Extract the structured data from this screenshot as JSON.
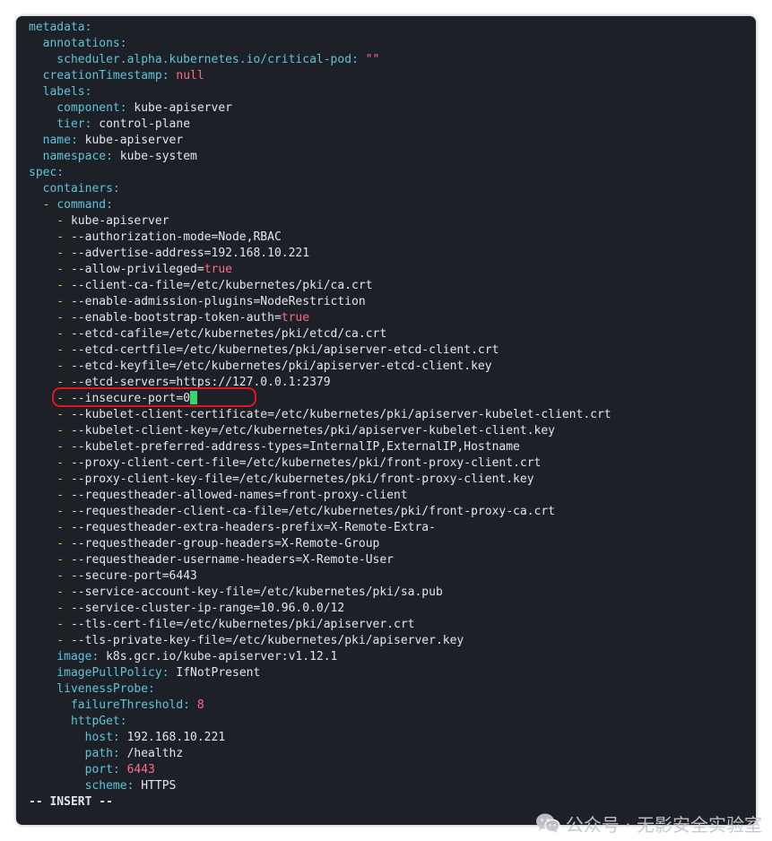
{
  "highlighted_line_index": 23,
  "lines": [
    [
      {
        "t": "metadata:",
        "c": "k"
      }
    ],
    [
      {
        "t": "  annotations:",
        "c": "k"
      }
    ],
    [
      {
        "t": "    scheduler.alpha.kubernetes.io/critical-pod:",
        "c": "k"
      },
      {
        "t": " \"\"",
        "c": "n"
      }
    ],
    [
      {
        "t": "  creationTimestamp:",
        "c": "k"
      },
      {
        "t": " null",
        "c": "n"
      }
    ],
    [
      {
        "t": "  labels:",
        "c": "k"
      }
    ],
    [
      {
        "t": "    component:",
        "c": "k"
      },
      {
        "t": " kube-apiserver",
        "c": "s"
      }
    ],
    [
      {
        "t": "    tier:",
        "c": "k"
      },
      {
        "t": " control-plane",
        "c": "s"
      }
    ],
    [
      {
        "t": "  name:",
        "c": "k"
      },
      {
        "t": " kube-apiserver",
        "c": "s"
      }
    ],
    [
      {
        "t": "  namespace:",
        "c": "k"
      },
      {
        "t": " kube-system",
        "c": "s"
      }
    ],
    [
      {
        "t": "spec:",
        "c": "k"
      }
    ],
    [
      {
        "t": "  containers:",
        "c": "k"
      }
    ],
    [
      {
        "t": "  - ",
        "c": "d"
      },
      {
        "t": "command:",
        "c": "k"
      }
    ],
    [
      {
        "t": "    - ",
        "c": "d"
      },
      {
        "t": "kube-apiserver",
        "c": "s"
      }
    ],
    [
      {
        "t": "    - ",
        "c": "d"
      },
      {
        "t": "--authorization-mode=Node,RBAC",
        "c": "s"
      }
    ],
    [
      {
        "t": "    - ",
        "c": "d"
      },
      {
        "t": "--advertise-address=192.168.10.221",
        "c": "s"
      }
    ],
    [
      {
        "t": "    - ",
        "c": "d"
      },
      {
        "t": "--allow-privileged=",
        "c": "s"
      },
      {
        "t": "true",
        "c": "n"
      }
    ],
    [
      {
        "t": "    - ",
        "c": "d"
      },
      {
        "t": "--client-ca-file=/etc/kubernetes/pki/ca.crt",
        "c": "s"
      }
    ],
    [
      {
        "t": "    - ",
        "c": "d"
      },
      {
        "t": "--enable-admission-plugins=NodeRestriction",
        "c": "s"
      }
    ],
    [
      {
        "t": "    - ",
        "c": "d"
      },
      {
        "t": "--enable-bootstrap-token-auth=",
        "c": "s"
      },
      {
        "t": "true",
        "c": "n"
      }
    ],
    [
      {
        "t": "    - ",
        "c": "d"
      },
      {
        "t": "--etcd-cafile=/etc/kubernetes/pki/etcd/ca.crt",
        "c": "s"
      }
    ],
    [
      {
        "t": "    - ",
        "c": "d"
      },
      {
        "t": "--etcd-certfile=/etc/kubernetes/pki/apiserver-etcd-client.crt",
        "c": "s"
      }
    ],
    [
      {
        "t": "    - ",
        "c": "d"
      },
      {
        "t": "--etcd-keyfile=/etc/kubernetes/pki/apiserver-etcd-client.key",
        "c": "s"
      }
    ],
    [
      {
        "t": "    - ",
        "c": "d"
      },
      {
        "t": "--etcd-servers=https://127.0.0.1:2379",
        "c": "s"
      }
    ],
    [
      {
        "t": "    - ",
        "c": "d"
      },
      {
        "t": "--insecure-port=0",
        "c": "s"
      },
      {
        "cursor": true
      }
    ],
    [
      {
        "t": "    - ",
        "c": "d"
      },
      {
        "t": "--kubelet-client-certificate=/etc/kubernetes/pki/apiserver-kubelet-client.crt",
        "c": "s"
      }
    ],
    [
      {
        "t": "    - ",
        "c": "d"
      },
      {
        "t": "--kubelet-client-key=/etc/kubernetes/pki/apiserver-kubelet-client.key",
        "c": "s"
      }
    ],
    [
      {
        "t": "    - ",
        "c": "d"
      },
      {
        "t": "--kubelet-preferred-address-types=InternalIP,ExternalIP,Hostname",
        "c": "s"
      }
    ],
    [
      {
        "t": "    - ",
        "c": "d"
      },
      {
        "t": "--proxy-client-cert-file=/etc/kubernetes/pki/front-proxy-client.crt",
        "c": "s"
      }
    ],
    [
      {
        "t": "    - ",
        "c": "d"
      },
      {
        "t": "--proxy-client-key-file=/etc/kubernetes/pki/front-proxy-client.key",
        "c": "s"
      }
    ],
    [
      {
        "t": "    - ",
        "c": "d"
      },
      {
        "t": "--requestheader-allowed-names=front-proxy-client",
        "c": "s"
      }
    ],
    [
      {
        "t": "    - ",
        "c": "d"
      },
      {
        "t": "--requestheader-client-ca-file=/etc/kubernetes/pki/front-proxy-ca.crt",
        "c": "s"
      }
    ],
    [
      {
        "t": "    - ",
        "c": "d"
      },
      {
        "t": "--requestheader-extra-headers-prefix=X-Remote-Extra-",
        "c": "s"
      }
    ],
    [
      {
        "t": "    - ",
        "c": "d"
      },
      {
        "t": "--requestheader-group-headers=X-Remote-Group",
        "c": "s"
      }
    ],
    [
      {
        "t": "    - ",
        "c": "d"
      },
      {
        "t": "--requestheader-username-headers=X-Remote-User",
        "c": "s"
      }
    ],
    [
      {
        "t": "    - ",
        "c": "d"
      },
      {
        "t": "--secure-port=6443",
        "c": "s"
      }
    ],
    [
      {
        "t": "    - ",
        "c": "d"
      },
      {
        "t": "--service-account-key-file=/etc/kubernetes/pki/sa.pub",
        "c": "s"
      }
    ],
    [
      {
        "t": "    - ",
        "c": "d"
      },
      {
        "t": "--service-cluster-ip-range=10.96.0.0/12",
        "c": "s"
      }
    ],
    [
      {
        "t": "    - ",
        "c": "d"
      },
      {
        "t": "--tls-cert-file=/etc/kubernetes/pki/apiserver.crt",
        "c": "s"
      }
    ],
    [
      {
        "t": "    - ",
        "c": "d"
      },
      {
        "t": "--tls-private-key-file=/etc/kubernetes/pki/apiserver.key",
        "c": "s"
      }
    ],
    [
      {
        "t": "    image:",
        "c": "k"
      },
      {
        "t": " k8s.gcr.io/kube-apiserver:v1.12.1",
        "c": "s"
      }
    ],
    [
      {
        "t": "    imagePullPolicy:",
        "c": "k"
      },
      {
        "t": " IfNotPresent",
        "c": "s"
      }
    ],
    [
      {
        "t": "    livenessProbe:",
        "c": "k"
      }
    ],
    [
      {
        "t": "      failureThreshold:",
        "c": "k"
      },
      {
        "t": " 8",
        "c": "n"
      }
    ],
    [
      {
        "t": "      httpGet:",
        "c": "k"
      }
    ],
    [
      {
        "t": "        host:",
        "c": "k"
      },
      {
        "t": " 192.168.10.221",
        "c": "s"
      }
    ],
    [
      {
        "t": "        path:",
        "c": "k"
      },
      {
        "t": " /healthz",
        "c": "s"
      }
    ],
    [
      {
        "t": "        port:",
        "c": "k"
      },
      {
        "t": " 6443",
        "c": "n"
      }
    ],
    [
      {
        "t": "        scheme:",
        "c": "k"
      },
      {
        "t": " HTTPS",
        "c": "s"
      }
    ]
  ],
  "status": {
    "mode": "-- INSERT --"
  },
  "watermark": {
    "text": "公众号 · 无影安全实验室",
    "icon": "wechat-icon"
  },
  "colors": {
    "background": "#1d2127",
    "key": "#5fc3d8",
    "string": "#e3e5ea",
    "literal": "#ff6b85",
    "dash": "#f5b949",
    "cursor": "#36d66a",
    "highlight_box": "#e6131f"
  }
}
